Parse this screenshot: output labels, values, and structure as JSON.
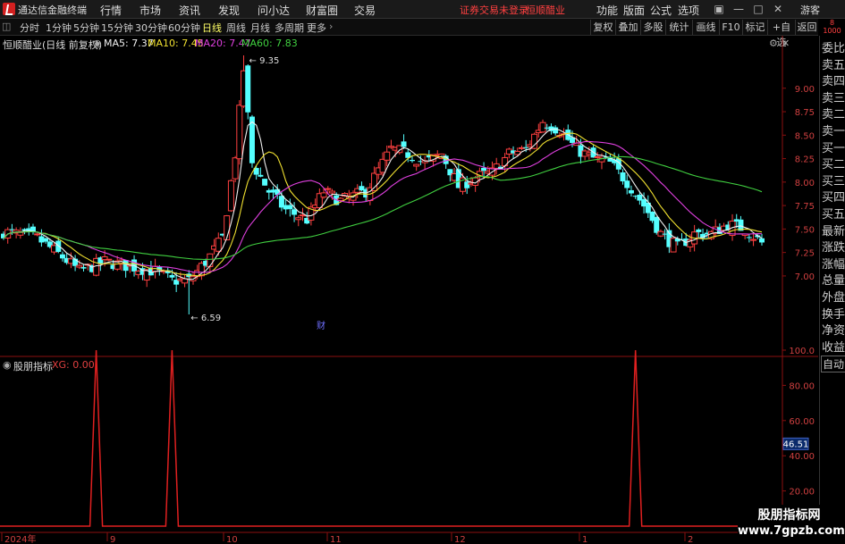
{
  "app": {
    "name": "通达信金融终端",
    "menu": [
      "行情",
      "市场",
      "资讯",
      "发现",
      "问小达",
      "财富圈",
      "交易"
    ],
    "alert": "证券交易未登录",
    "stock_label": "恒顺醋业",
    "right_menu": [
      "功能",
      "版面",
      "公式",
      "选项"
    ],
    "guest": "游客"
  },
  "toolbar": {
    "periods": [
      "分时",
      "1分钟",
      "5分钟",
      "15分钟",
      "30分钟",
      "60分钟",
      "日线",
      "周线",
      "月线",
      "多周期",
      "更多"
    ],
    "active": "日线",
    "right_buttons": [
      "复权",
      "叠加",
      "多股",
      "统计",
      "画线",
      "F10",
      "标记",
      "+自选",
      "返回"
    ]
  },
  "corner": {
    "line1": "8",
    "line2": "1000"
  },
  "main_chart": {
    "title": "恒顺醋业(日线 前复权)",
    "ma": [
      {
        "label": "MA5: 7.37",
        "color": "#f0f0f0"
      },
      {
        "label": "MA10: 7.45",
        "color": "#f0e030"
      },
      {
        "label": "MA20: 7.47",
        "color": "#e040e0"
      },
      {
        "label": "MA60: 7.83",
        "color": "#40d040"
      }
    ],
    "high_label": "9.35",
    "low_label": "6.59",
    "marker": "财",
    "price_ticks": [
      "9.00",
      "8.75",
      "8.50",
      "8.25",
      "8.00",
      "7.75",
      "7.50",
      "7.25",
      "7.00"
    ]
  },
  "indicator": {
    "title": "股朋指标",
    "xg": "XG: 0.00",
    "ticks": [
      "100.0",
      "80.00",
      "60.00",
      "40.00",
      "20.00"
    ],
    "cursor_value": "46.51"
  },
  "x_axis": [
    "2024年",
    "9",
    "10",
    "11",
    "12",
    "1",
    "2"
  ],
  "side_panel": [
    "委比",
    "卖五",
    "卖四",
    "卖三",
    "卖二",
    "卖一",
    "买一",
    "买二",
    "买三",
    "买四",
    "买五",
    "最新",
    "涨跌",
    "涨幅",
    "总量",
    "外盘",
    "换手",
    "净资",
    "收益",
    "自动"
  ],
  "watermark": {
    "line1": "股朋指标网",
    "line2": "www.7gpzb.com"
  },
  "colors": {
    "up": "#ff4040",
    "down": "#54ffff",
    "ma5": "#f0f0f0",
    "ma10": "#f0e030",
    "ma20": "#e040e0",
    "ma60": "#40d040",
    "signal": "#e02020"
  },
  "chart_data": {
    "type": "candlestick",
    "signal_bars": [
      22,
      40,
      150
    ],
    "bar_count": 181
  }
}
